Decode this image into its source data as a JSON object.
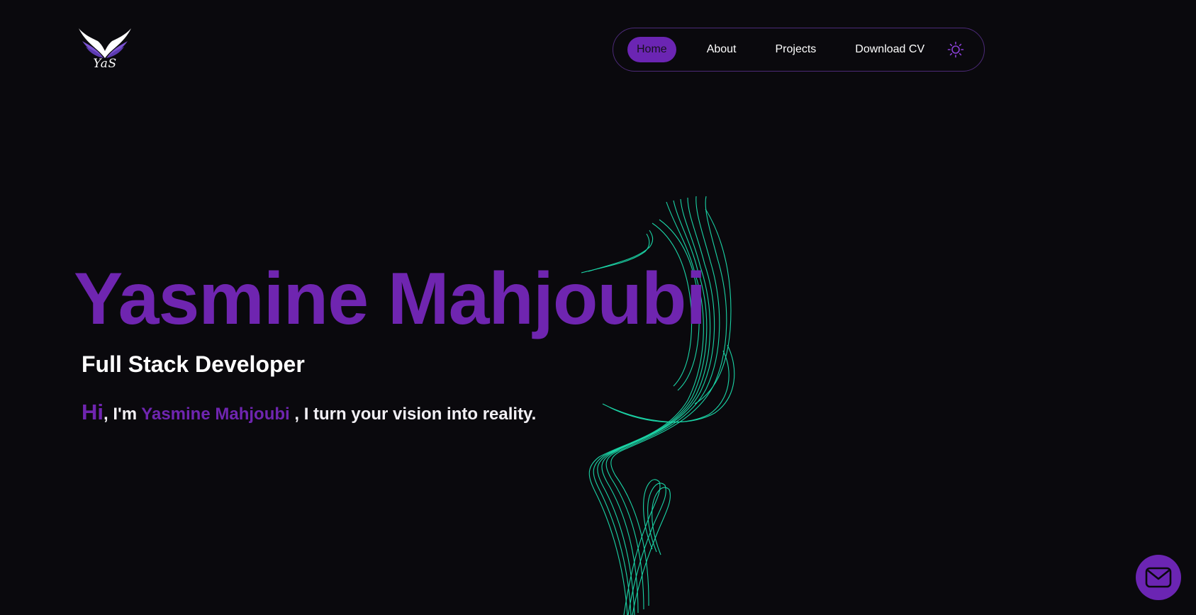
{
  "brand": {
    "logo_text": "YaS"
  },
  "nav": {
    "items": [
      {
        "label": "Home",
        "active": true
      },
      {
        "label": "About",
        "active": false
      },
      {
        "label": "Projects",
        "active": false
      },
      {
        "label": "Download CV",
        "active": false
      }
    ],
    "theme_toggle_icon": "sun-icon"
  },
  "hero": {
    "name": "Yasmine Mahjoubi",
    "role": "Full Stack Developer",
    "tagline": {
      "greeting": "Hi",
      "intro": ", I'm ",
      "name": "Yasmine Mahjoubi",
      "rest": " , I turn your vision into reality."
    }
  },
  "contact_button": {
    "icon": "mail-icon"
  },
  "colors": {
    "background": "#0a090d",
    "accent": "#6f25b0",
    "swirl": "#1de9b6"
  }
}
